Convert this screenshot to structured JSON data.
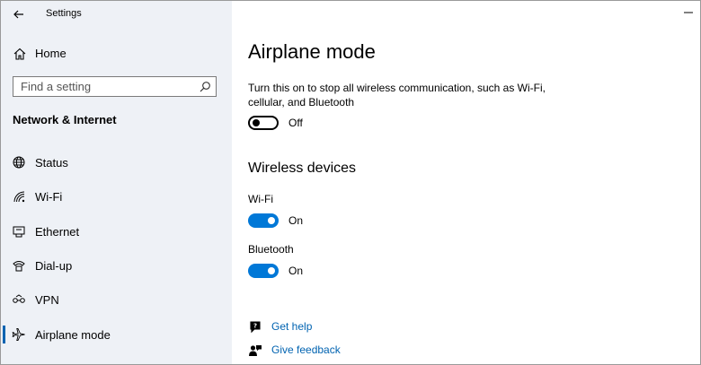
{
  "window": {
    "title": "Settings"
  },
  "sidebar": {
    "home_label": "Home",
    "search_placeholder": "Find a setting",
    "section_title": "Network & Internet",
    "items": [
      {
        "label": "Status",
        "icon": "status-globe-icon"
      },
      {
        "label": "Wi-Fi",
        "icon": "wifi-icon"
      },
      {
        "label": "Ethernet",
        "icon": "ethernet-icon"
      },
      {
        "label": "Dial-up",
        "icon": "dialup-icon"
      },
      {
        "label": "VPN",
        "icon": "vpn-icon"
      },
      {
        "label": "Airplane mode",
        "icon": "airplane-icon",
        "selected": true
      }
    ]
  },
  "main": {
    "title": "Airplane mode",
    "description": "Turn this on to stop all wireless communication, such as Wi-Fi, cellular, and Bluetooth",
    "airplane_toggle": {
      "state": "Off",
      "on": false
    },
    "wireless_heading": "Wireless devices",
    "devices": [
      {
        "label": "Wi-Fi",
        "state": "On",
        "on": true
      },
      {
        "label": "Bluetooth",
        "state": "On",
        "on": true
      }
    ],
    "links": [
      {
        "label": "Get help",
        "icon": "help-chat-icon"
      },
      {
        "label": "Give feedback",
        "icon": "feedback-icon"
      }
    ]
  },
  "colors": {
    "sidebar_bg": "#eef1f6",
    "accent": "#0078d7",
    "link": "#0063b1"
  }
}
